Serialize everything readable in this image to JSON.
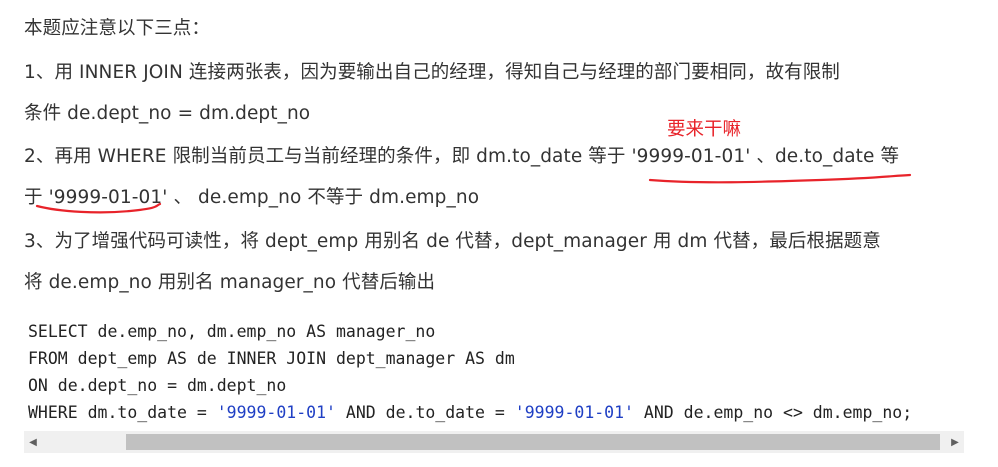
{
  "paragraphs": {
    "p1": "本题应注意以下三点：",
    "p2": "1、用 INNER JOIN 连接两张表，因为要输出自己的经理，得知自己与经理的部门要相同，故有限制",
    "p3": "条件 de.dept_no = dm.dept_no",
    "p4": "2、再用 WHERE 限制当前员工与当前经理的条件，即 dm.to_date 等于 '9999-01-01' 、de.to_date 等",
    "p5": "于 '9999-01-01' 、 de.emp_no 不等于 dm.emp_no",
    "p6": "3、为了增强代码可读性，将 dept_emp 用别名 de 代替，dept_manager 用 dm 代替，最后根据题意",
    "p7": "将 de.emp_no 用别名 manager_no 代替后输出"
  },
  "annotation": {
    "text": "要来干嘛",
    "color": "#e8232a"
  },
  "code": {
    "line1": "SELECT de.emp_no, dm.emp_no AS manager_no",
    "line2": "FROM dept_emp AS de INNER JOIN dept_manager AS dm",
    "line3": "ON de.dept_no = dm.dept_no",
    "line4_a": "WHERE dm.to_date = ",
    "line4_str1": "'9999-01-01'",
    "line4_b": " AND de.to_date = ",
    "line4_str2": "'9999-01-01'",
    "line4_c": " AND de.emp_no <> dm.emp_no;",
    "string_color": "#1f3fc4"
  },
  "scrollbar": {
    "left_arrow_icon": "triangle-left-icon",
    "right_arrow_icon": "triangle-right-icon"
  }
}
